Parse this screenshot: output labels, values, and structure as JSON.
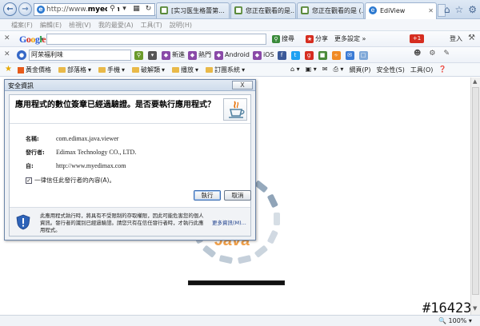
{
  "browser": {
    "url_prefix": "http://www.",
    "url_domain": "myedima",
    "tabs": [
      {
        "label": "[实习医生格蕾第..."
      },
      {
        "label": "您正在觀看的是..."
      },
      {
        "label": "您正在觀看的是 (..."
      },
      {
        "label": "EdiView"
      }
    ]
  },
  "menu": [
    "檔案(F)",
    "編輯(E)",
    "檢視(V)",
    "我的最愛(A)",
    "工具(T)",
    "說明(H)"
  ],
  "google_bar": {
    "logo_letters": [
      "G",
      "o",
      "o",
      "g",
      "l",
      "e"
    ],
    "search_label": "搜尋",
    "share_label": "分享",
    "more_label": "更多設定 »",
    "gplus_label": "+1",
    "login_label": "登入"
  },
  "search_bar": {
    "input_text": "阿荣福利味",
    "items": [
      "新進",
      "熱門",
      "Android",
      "iOS"
    ]
  },
  "favorites": {
    "items": [
      "黃金價格",
      "部落格",
      "手機",
      "破解類",
      "播放",
      "訂團系統"
    ],
    "tools": [
      "網頁(P)",
      "安全性(S)",
      "工具(O)"
    ]
  },
  "dialog": {
    "title": "安全資訊",
    "close_label": "X",
    "heading": "應用程式的數位簽章已經過驗證。是否要執行應用程式？",
    "name_label": "名稱:",
    "name_value": "com.edimax.java.viewer",
    "publisher_label": "發行者:",
    "publisher_value": "Edimax Technology CO., LTD.",
    "from_label": "自:",
    "from_value": "http://www.myedimax.com",
    "trust_label": "一律信任此發行者的內容(A)。",
    "run_label": "執行",
    "cancel_label": "取消",
    "footer_text": "此應用程式執行時，將具有不受限制的存取權限，因此可能危害您的個人資訊。發行者的識別已經過驗證。請您只有在信任發行者時，才執行此應用程式。",
    "more_info_label": "更多資訊(M)..."
  },
  "page": {
    "java_text": "Java",
    "progress_value": 1.0
  },
  "status": {
    "zoom": "100%",
    "watermark": "#16423"
  }
}
